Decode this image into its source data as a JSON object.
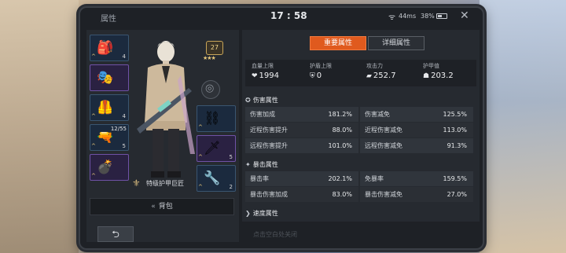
{
  "status": {
    "panel_title": "属性",
    "time": "17 : 58",
    "network": "44ms",
    "battery": "38%"
  },
  "left": {
    "slots": [
      {
        "icon": "🎒",
        "level": "4",
        "rank": "^"
      },
      {
        "icon": "🎭",
        "level": "",
        "rank": ""
      },
      {
        "icon": "🦺",
        "level": "4",
        "rank": "^"
      },
      {
        "icon": "🔫",
        "level": "5",
        "rank": "^",
        "ammo": "12/55"
      },
      {
        "icon": "💣",
        "level": "",
        "rank": "^"
      },
      {
        "icon": "⛓",
        "level": "",
        "rank": "^"
      },
      {
        "icon": "🗡",
        "level": "5",
        "rank": "^"
      },
      {
        "icon": "🔧",
        "level": "2",
        "rank": "^"
      }
    ],
    "badge_level": "27",
    "badge_stars": "★★★",
    "title_text": "特级护甲巨匠",
    "bag_label": "背包"
  },
  "right": {
    "tab_main": "重要属性",
    "tab_detail": "详细属性",
    "top_stats": [
      {
        "label": "血量上限",
        "icon": "❤",
        "value": "1994"
      },
      {
        "label": "护盾上限",
        "icon": "⛨",
        "value": "0"
      },
      {
        "label": "攻击力",
        "icon": "▰",
        "value": "252.7"
      },
      {
        "label": "护甲值",
        "icon": "☗",
        "value": "203.2"
      }
    ],
    "damage_section": "伤害属性",
    "damage_rows": [
      [
        "伤害加成",
        "181.2%",
        "伤害减免",
        "125.5%"
      ],
      [
        "近程伤害提升",
        "88.0%",
        "近程伤害减免",
        "113.0%"
      ],
      [
        "远程伤害提升",
        "101.0%",
        "远程伤害减免",
        "91.3%"
      ]
    ],
    "crit_section": "暴击属性",
    "crit_rows": [
      [
        "暴击率",
        "202.1%",
        "免暴率",
        "159.5%"
      ],
      [
        "暴击伤害加成",
        "83.0%",
        "暴击伤害减免",
        "27.0%"
      ]
    ],
    "speed_section": "速度属性"
  },
  "footer": {
    "back_icon": "⮌",
    "hint": "点击空白处关闭"
  }
}
